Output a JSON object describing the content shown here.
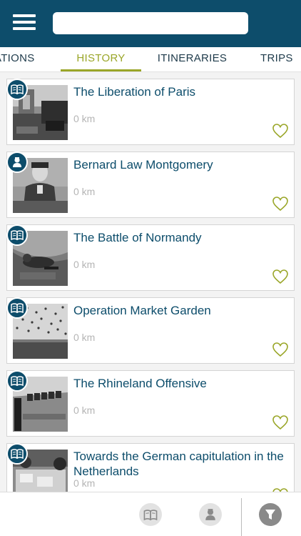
{
  "search": {
    "value": "",
    "placeholder": ""
  },
  "tabs": [
    {
      "label": "ATIONS",
      "active": false
    },
    {
      "label": "HISTORY",
      "active": true
    },
    {
      "label": "ITINERARIES",
      "active": false
    },
    {
      "label": "TRIPS",
      "active": false
    }
  ],
  "items": [
    {
      "title": "The Liberation of Paris",
      "distance": "0 km",
      "badge_icon": "book-icon"
    },
    {
      "title": "Bernard Law Montgomery",
      "distance": "0 km",
      "badge_icon": "person-icon"
    },
    {
      "title": "The Battle of Normandy",
      "distance": "0 km",
      "badge_icon": "book-icon"
    },
    {
      "title": "Operation Market Garden",
      "distance": "0 km",
      "badge_icon": "book-icon"
    },
    {
      "title": "The Rhineland Offensive",
      "distance": "0 km",
      "badge_icon": "book-icon"
    },
    {
      "title": "Towards the German capitulation in the Netherlands",
      "distance": "0 km",
      "badge_icon": "book-icon"
    }
  ],
  "bottom_bar": {
    "buttons": [
      {
        "icon": "book-icon"
      },
      {
        "icon": "person-icon"
      },
      {
        "icon": "filter-icon"
      }
    ]
  },
  "colors": {
    "header": "#0d4d6b",
    "accent": "#9aa628",
    "title_text": "#0d4d6b",
    "distance_text": "#b5b5b5"
  }
}
